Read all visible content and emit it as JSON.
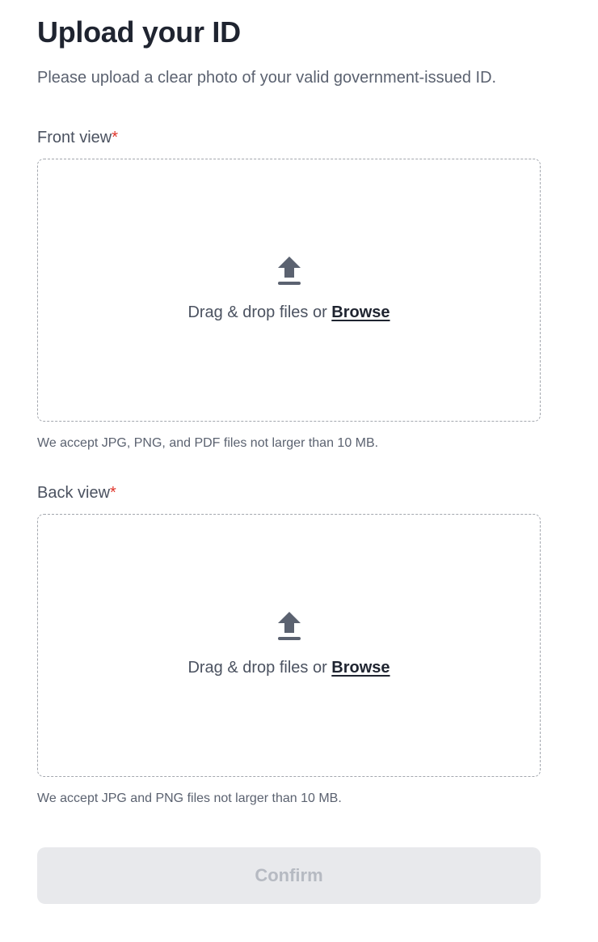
{
  "header": {
    "title": "Upload your ID",
    "subtitle": "Please upload a clear photo of your valid government-issued ID."
  },
  "front": {
    "label": "Front view",
    "required_mark": "*",
    "drop_text": "Drag & drop files or",
    "browse_label": "Browse",
    "icon": "upload-icon",
    "help_text": "We accept JPG, PNG, and PDF files not larger than 10 MB."
  },
  "back": {
    "label": "Back view",
    "required_mark": "*",
    "drop_text": "Drag & drop files or",
    "browse_label": "Browse",
    "icon": "upload-icon",
    "help_text": "We accept JPG and PNG files not larger than 10 MB."
  },
  "actions": {
    "confirm_label": "Confirm",
    "confirm_disabled": true
  },
  "colors": {
    "required": "#e0352b",
    "icon": "#5b6270",
    "button_bg_disabled": "#e8e9ec",
    "button_text_disabled": "#b6bac2",
    "dashed_border": "#a3a7ae"
  }
}
